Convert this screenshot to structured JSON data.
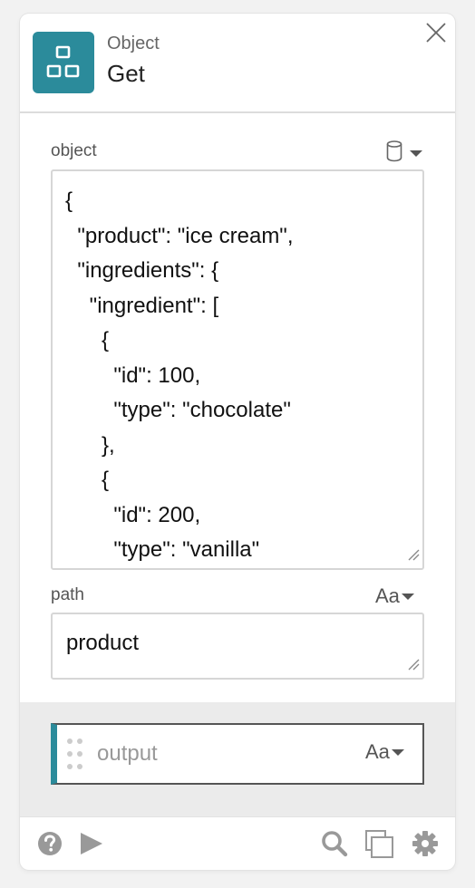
{
  "header": {
    "subtitle": "Object",
    "title": "Get",
    "icon": "object-icon",
    "accent_color": "#2b8b9b"
  },
  "fields": {
    "object": {
      "label": "object",
      "value": "{\n  \"product\": \"ice cream\",\n  \"ingredients\": {\n    \"ingredient\": [\n      {\n        \"id\": 100,\n        \"type\": \"chocolate\"\n      },\n      {\n        \"id\": 200,\n        \"type\": \"vanilla\"",
      "type_icon": "database-icon"
    },
    "path": {
      "label": "path",
      "value": "product",
      "type_label": "Aa"
    }
  },
  "output": {
    "placeholder": "output",
    "type_label": "Aa"
  },
  "footer": {
    "icons": [
      "help-icon",
      "run-icon",
      "search-icon",
      "copy-icon",
      "settings-icon"
    ]
  }
}
